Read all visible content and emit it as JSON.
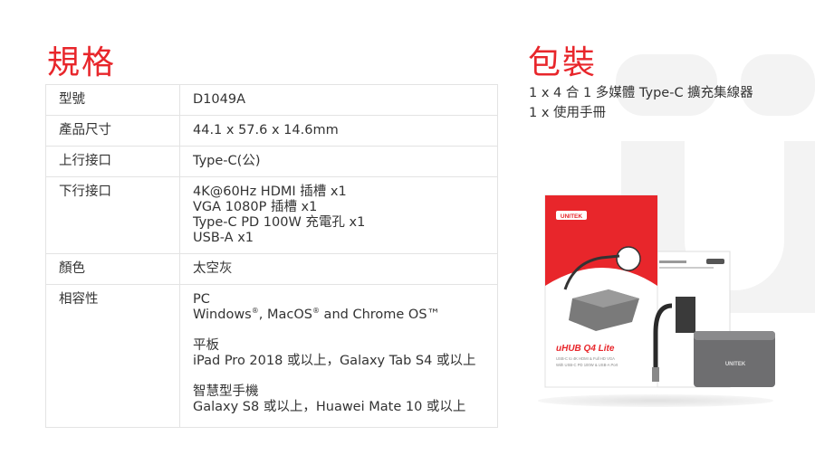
{
  "headings": {
    "spec": "規格",
    "package": "包裝"
  },
  "specs": [
    {
      "key": "型號",
      "lines": [
        "D1049A"
      ]
    },
    {
      "key": "產品尺寸",
      "lines": [
        "44.1 x 57.6 x 14.6mm"
      ]
    },
    {
      "key": "上行接口",
      "lines": [
        "Type-C(公)"
      ]
    },
    {
      "key": "下行接口",
      "lines": [
        "4K@60Hz HDMI 插槽 x1",
        "VGA 1080P 插槽 x1",
        "Type-C PD 100W 充電孔 x1",
        "USB-A x1"
      ]
    },
    {
      "key": "顏色",
      "lines": [
        "太空灰"
      ]
    },
    {
      "key": "相容性",
      "line1": "PC",
      "line2_a": "Windows",
      "line2_b": ", MacOS",
      "line2_c": " and Chrome OS™",
      "reg": "®",
      "line3": "平板",
      "line4": "iPad Pro 2018 或以上，Galaxy Tab S4 或以上",
      "line5": "智慧型手機",
      "line6": "Galaxy S8 或以上，Huawei Mate 10 或以上"
    }
  ],
  "package_items": [
    "1 x 4 合 1 多媒體 Type-C 擴充集線器",
    "1 x 使用手冊"
  ],
  "product": {
    "brand": "UNITEK",
    "name": "uHUB Q4 Lite",
    "desc1": "USB-C to 4K HDMI & Full HD VGA",
    "desc2": "With USB-C PD 100W & USB-A Port",
    "accent": "#e8262b"
  }
}
